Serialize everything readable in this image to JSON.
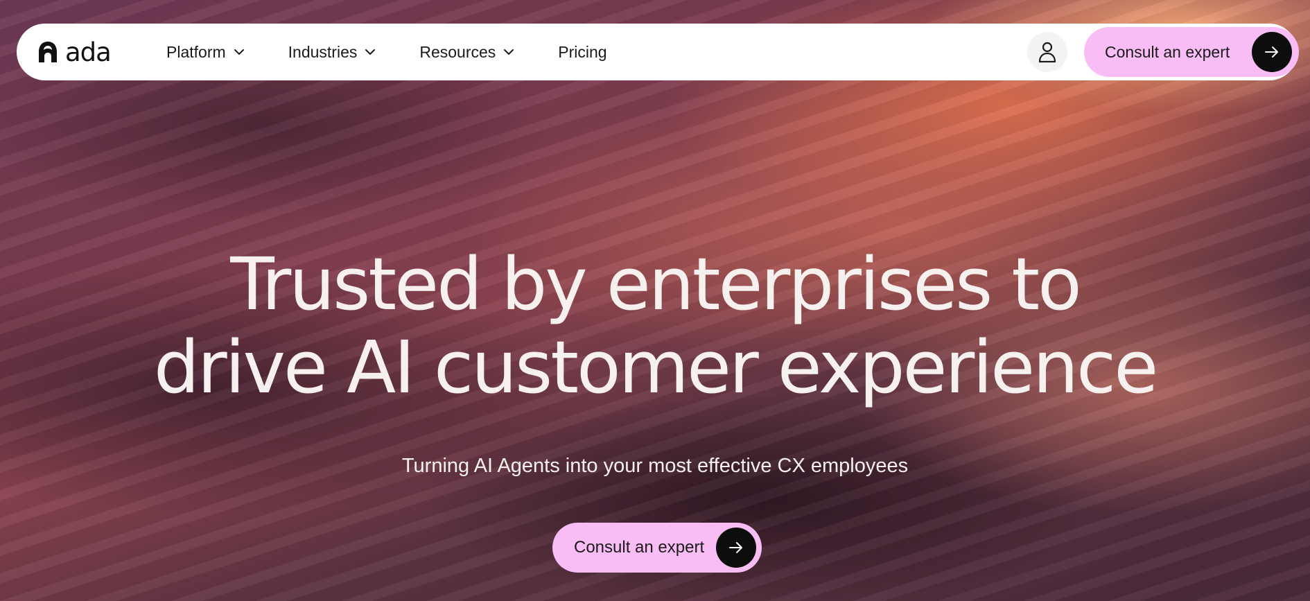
{
  "brand": {
    "name": "ada"
  },
  "nav": {
    "items": [
      {
        "label": "Platform",
        "has_dropdown": true
      },
      {
        "label": "Industries",
        "has_dropdown": true
      },
      {
        "label": "Resources",
        "has_dropdown": true
      },
      {
        "label": "Pricing",
        "has_dropdown": false
      }
    ],
    "account_icon": "user-icon",
    "cta_label": "Consult an expert",
    "cta_icon": "arrow-right-icon"
  },
  "hero": {
    "title_line1": "Trusted by enterprises to",
    "title_line2": "drive AI customer experience",
    "subtitle": "Turning AI Agents into your most effective CX employees",
    "cta_label": "Consult an expert",
    "cta_icon": "arrow-right-icon"
  },
  "colors": {
    "cta_background": "#f8bdf5",
    "cta_icon_background": "#0d0d0d",
    "nav_background": "#ffffff",
    "hero_text": "#f6f1ef"
  }
}
